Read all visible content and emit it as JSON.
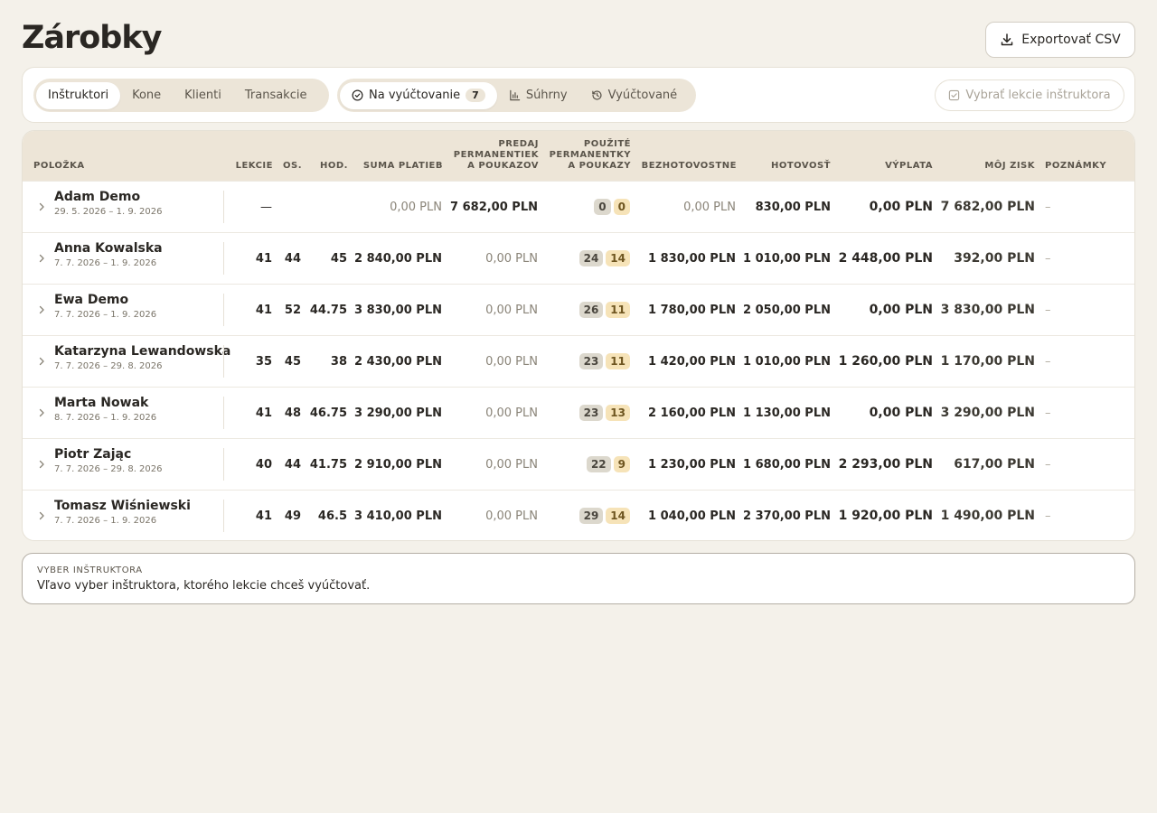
{
  "header": {
    "title": "Zárobky",
    "export_label": "Exportovať CSV"
  },
  "tabs_primary": [
    {
      "label": "Inštruktori",
      "active": true
    },
    {
      "label": "Kone",
      "active": false
    },
    {
      "label": "Klienti",
      "active": false
    },
    {
      "label": "Transakcie",
      "active": false
    }
  ],
  "tabs_secondary": [
    {
      "label": "Na vyúčtovanie",
      "count": "7",
      "icon": "check-circle-icon",
      "active": true
    },
    {
      "label": "Súhrny",
      "icon": "bar-chart-icon",
      "active": false
    },
    {
      "label": "Vyúčtované",
      "icon": "history-icon",
      "active": false
    }
  ],
  "select_button": {
    "label": "Vybrať lekcie inštruktora",
    "disabled": true
  },
  "table": {
    "columns": {
      "item": "POLOŽKA",
      "lessons": "LEKCIE",
      "persons": "OS.",
      "hours": "HOD.",
      "payments_sum": "SUMA PLATIEB",
      "passes_sold": [
        "PREDAJ",
        "PERMANENTIEK",
        "A POUKAZOV"
      ],
      "passes_used": [
        "POUŽITÉ",
        "PERMANENTKY",
        "A POUKAZY"
      ],
      "cashless": "BEZHOTOVOSTNE",
      "cash": "HOTOVOSŤ",
      "payout": "VÝPLATA",
      "my_profit": "MÔJ ZISK",
      "notes": "POZNÁMKY"
    },
    "rows": [
      {
        "name": "Adam Demo",
        "dates": "29. 5. 2026 – 1. 9. 2026",
        "lessons": "—",
        "persons": "",
        "hours": "",
        "payments_sum": "0,00 PLN",
        "passes_sold": "7 682,00 PLN",
        "used_a": "0",
        "used_b": "0",
        "cashless": "0,00 PLN",
        "cash": "830,00 PLN",
        "payout": "0,00 PLN",
        "profit": "7 682,00 PLN",
        "notes": "–"
      },
      {
        "name": "Anna Kowalska",
        "dates": "7. 7. 2026 – 1. 9. 2026",
        "lessons": "41",
        "persons": "44",
        "hours": "45",
        "payments_sum": "2 840,00 PLN",
        "passes_sold": "0,00 PLN",
        "used_a": "24",
        "used_b": "14",
        "cashless": "1 830,00 PLN",
        "cash": "1 010,00 PLN",
        "payout": "2 448,00 PLN",
        "profit": "392,00 PLN",
        "notes": "–"
      },
      {
        "name": "Ewa Demo",
        "dates": "7. 7. 2026 – 1. 9. 2026",
        "lessons": "41",
        "persons": "52",
        "hours": "44.75",
        "payments_sum": "3 830,00 PLN",
        "passes_sold": "0,00 PLN",
        "used_a": "26",
        "used_b": "11",
        "cashless": "1 780,00 PLN",
        "cash": "2 050,00 PLN",
        "payout": "0,00 PLN",
        "profit": "3 830,00 PLN",
        "notes": "–"
      },
      {
        "name": "Katarzyna Lewandowska",
        "dates": "7. 7. 2026 – 29. 8. 2026",
        "lessons": "35",
        "persons": "45",
        "hours": "38",
        "payments_sum": "2 430,00 PLN",
        "passes_sold": "0,00 PLN",
        "used_a": "23",
        "used_b": "11",
        "cashless": "1 420,00 PLN",
        "cash": "1 010,00 PLN",
        "payout": "1 260,00 PLN",
        "profit": "1 170,00 PLN",
        "notes": "–"
      },
      {
        "name": "Marta Nowak",
        "dates": "8. 7. 2026 – 1. 9. 2026",
        "lessons": "41",
        "persons": "48",
        "hours": "46.75",
        "payments_sum": "3 290,00 PLN",
        "passes_sold": "0,00 PLN",
        "used_a": "23",
        "used_b": "13",
        "cashless": "2 160,00 PLN",
        "cash": "1 130,00 PLN",
        "payout": "0,00 PLN",
        "profit": "3 290,00 PLN",
        "notes": "–"
      },
      {
        "name": "Piotr Zając",
        "dates": "7. 7. 2026 – 29. 8. 2026",
        "lessons": "40",
        "persons": "44",
        "hours": "41.75",
        "payments_sum": "2 910,00 PLN",
        "passes_sold": "0,00 PLN",
        "used_a": "22",
        "used_b": "9",
        "cashless": "1 230,00 PLN",
        "cash": "1 680,00 PLN",
        "payout": "2 293,00 PLN",
        "profit": "617,00 PLN",
        "notes": "–"
      },
      {
        "name": "Tomasz Wiśniewski",
        "dates": "7. 7. 2026 – 1. 9. 2026",
        "lessons": "41",
        "persons": "49",
        "hours": "46.5",
        "payments_sum": "3 410,00 PLN",
        "passes_sold": "0,00 PLN",
        "used_a": "29",
        "used_b": "14",
        "cashless": "1 040,00 PLN",
        "cash": "2 370,00 PLN",
        "payout": "1 920,00 PLN",
        "profit": "1 490,00 PLN",
        "notes": "–"
      }
    ]
  },
  "info": {
    "title": "VYBER INŠTRUKTORA",
    "text": "Vľavo vyber inštruktora, ktorého lekcie chceš vyúčtovať."
  },
  "colors": {
    "background": "#f4f1ea",
    "header_row": "#ede5d7",
    "pill_gray": "#dcd8cd",
    "pill_yellow": "#f6e3b8"
  }
}
